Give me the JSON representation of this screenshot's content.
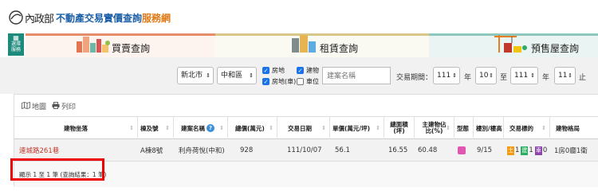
{
  "header": {
    "ministry": "內政部",
    "title_main": "不動產交易實價查詢",
    "title_accent": "服務網"
  },
  "side_button": {
    "line1": "選擇",
    "line2": "服務",
    "glyph": "▦"
  },
  "tabs": [
    {
      "label": "買賣查詢",
      "icon": "city-buildings-icon"
    },
    {
      "label": "租賃查詢",
      "icon": "apartment-icon"
    },
    {
      "label": "預售屋查詢",
      "icon": "crane-construction-icon"
    }
  ],
  "filter": {
    "city": "新北市",
    "district": "中和區",
    "checkboxes": [
      {
        "label": "房地",
        "checked": true
      },
      {
        "label": "建物",
        "checked": true
      },
      {
        "label": "房地(車)",
        "checked": true
      },
      {
        "label": "車位",
        "checked": false
      }
    ],
    "search_placeholder": "建案名稱",
    "period_label": "交易期間：",
    "start_year": "111",
    "year_unit": "年",
    "start_month": "10",
    "to_label": "至",
    "end_year": "111",
    "end_month": "11",
    "end_label": "止"
  },
  "toolbar": {
    "map_label": "地圖",
    "print_label": "列印"
  },
  "table": {
    "columns": [
      "建物坐落",
      "棟及號",
      "建案名稱",
      "總價(萬元)",
      "交易日期",
      "單價(萬元/坪)",
      "總面積(坪)",
      "主建物佔比(%)",
      "型態",
      "樓別/樓高",
      "交易標的",
      "建物格局"
    ],
    "rows": [
      {
        "address": "連城路261巷",
        "building": "A棟8號",
        "project": "利舟荷悅(中和)",
        "total_price": "928",
        "date": "111/10/07",
        "unit_price": "56.1",
        "area": "16.55",
        "main_ratio": "60.48",
        "type_badge": "",
        "floor": "9/15",
        "target_badges": [
          "土",
          "1",
          "建",
          "1",
          "車",
          "0"
        ],
        "layout": "1房0廳1衛"
      }
    ]
  },
  "footer": {
    "summary": "顯示 1 至 1 筆 (查詢結果：1 筆)"
  },
  "colors": {
    "accent_blue": "#1b5fa8",
    "accent_orange": "#e07a16",
    "highlight_red": "#e00000",
    "badge_land": "#f39c12",
    "badge_building": "#27ae60",
    "badge_parking": "#8e44ad",
    "badge_type": "#e056b0"
  }
}
